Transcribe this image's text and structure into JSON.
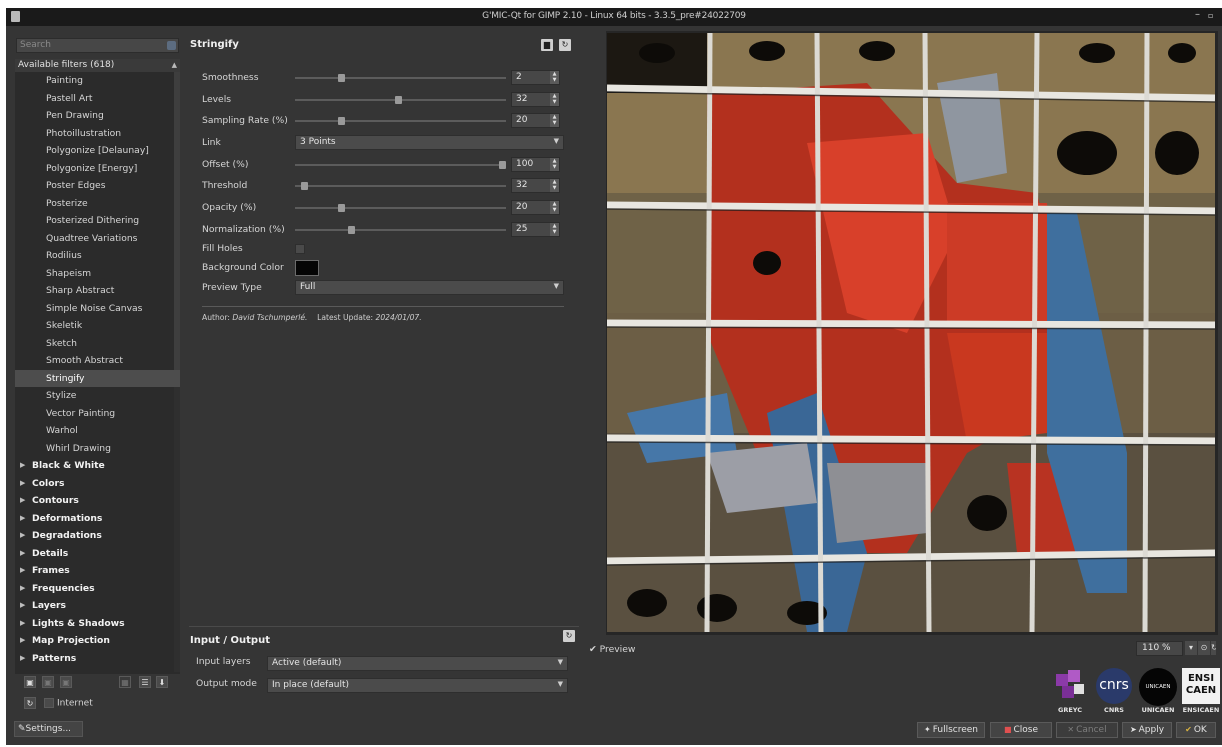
{
  "window": {
    "title": "G'MIC-Qt for GIMP 2.10 - Linux 64 bits - 3.3.5_pre#24022709"
  },
  "search": {
    "placeholder": "Search"
  },
  "tree": {
    "header": "Available filters (618)",
    "filters": [
      "Painting",
      "Pastell Art",
      "Pen Drawing",
      "Photoillustration",
      "Polygonize [Delaunay]",
      "Polygonize [Energy]",
      "Poster Edges",
      "Posterize",
      "Posterized Dithering",
      "Quadtree Variations",
      "Rodilius",
      "Shapeism",
      "Sharp Abstract",
      "Simple Noise Canvas",
      "Skeletik",
      "Sketch",
      "Smooth Abstract",
      "Stringify",
      "Stylize",
      "Vector Painting",
      "Warhol",
      "Whirl Drawing"
    ],
    "selected": "Stringify",
    "categories": [
      "Black & White",
      "Colors",
      "Contours",
      "Deformations",
      "Degradations",
      "Details",
      "Frames",
      "Frequencies",
      "Layers",
      "Lights & Shadows",
      "Map Projection",
      "Patterns"
    ]
  },
  "internet_label": "Internet",
  "settings_label": "Settings...",
  "filter": {
    "name": "Stringify",
    "params": {
      "smoothness": {
        "label": "Smoothness",
        "value": "2",
        "level": 0.21
      },
      "levels": {
        "label": "Levels",
        "value": "32",
        "level": 0.49
      },
      "sampling": {
        "label": "Sampling Rate (%)",
        "value": "20",
        "level": 0.21
      },
      "link": {
        "label": "Link",
        "value": "3 Points"
      },
      "offset": {
        "label": "Offset (%)",
        "value": "100",
        "level": 1.0
      },
      "threshold": {
        "label": "Threshold",
        "value": "32",
        "level": 0.03
      },
      "opacity": {
        "label": "Opacity (%)",
        "value": "20",
        "level": 0.21
      },
      "normalization": {
        "label": "Normalization (%)",
        "value": "25",
        "level": 0.26
      },
      "fillholes": {
        "label": "Fill Holes"
      },
      "bgcolor": {
        "label": "Background Color",
        "color": "#050505"
      },
      "previewtype": {
        "label": "Preview Type",
        "value": "Full"
      }
    },
    "author_prefix": "Author:",
    "author_name": "David Tschumperlé.",
    "update_prefix": "Latest Update:",
    "update_date": "2024/01/07."
  },
  "io": {
    "title": "Input / Output",
    "input_label": "Input layers",
    "input_value": "Active (default)",
    "output_label": "Output mode",
    "output_value": "In place (default)"
  },
  "preview": {
    "label": "Preview",
    "zoom": "110 %"
  },
  "logos": {
    "greyc": "GREYC",
    "cnrs_mark": "cnrs",
    "cnrs": "CNRS",
    "unicaen_mark": "UNICAEN",
    "unicaen": "UNICAEN",
    "ensi_line1": "ENSI",
    "ensi_line2": "CAEN",
    "ensicaen": "ENSICAEN"
  },
  "buttons": {
    "fullscreen": "Fullscreen",
    "close": "Close",
    "cancel": "Cancel",
    "apply": "Apply",
    "ok": "OK"
  }
}
